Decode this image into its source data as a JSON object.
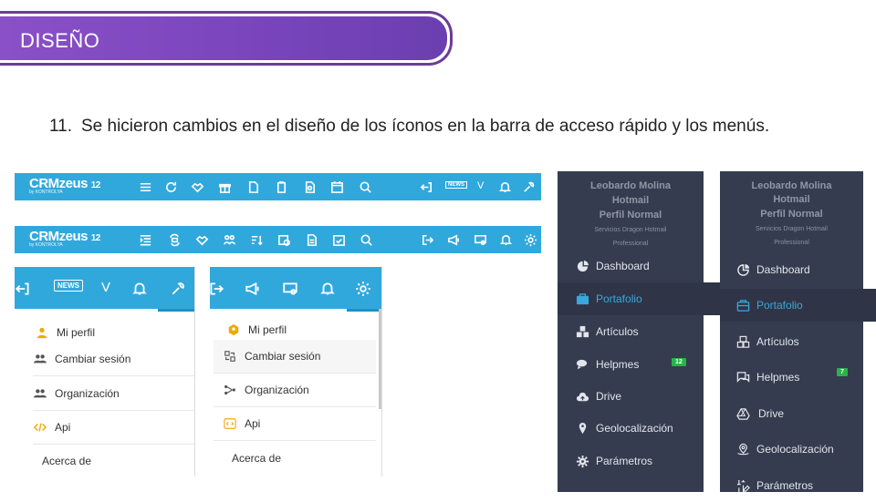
{
  "slide": {
    "title": "DISEÑO",
    "item_number": "11.",
    "item_text": "Se hicieron cambios en el diseño de los íconos en la barra de acceso rápido y los menús."
  },
  "colors": {
    "purple": "#7a45bd",
    "toolbar_blue": "#31a8dc",
    "sidebar_dark": "#353c4f",
    "active_blue": "#3aa7dd",
    "badge_green": "#29b34a"
  },
  "toolbars": {
    "old": {
      "logo": "CRMzeus",
      "logo_sub": "by KONTROLYA",
      "news_label": "NEWS",
      "v_label": "V"
    },
    "new": {
      "logo": "CRMzeus",
      "logo_sub": "by KONTROLYA"
    }
  },
  "old_menu": {
    "news_label": "NEWS",
    "v_label": "V",
    "items": [
      {
        "label": "Mi perfil",
        "icon": "user-icon"
      },
      {
        "label": "Cambiar sesión",
        "icon": "users-icon"
      },
      {
        "label": "Organización",
        "icon": "users-icon"
      },
      {
        "label": "Api",
        "icon": "code-icon"
      },
      {
        "label": "Acerca de",
        "icon": ""
      }
    ]
  },
  "new_menu": {
    "items": [
      {
        "label": "Mi perfil",
        "icon": "hexagon-user-icon"
      },
      {
        "label": "Cambiar sesión",
        "icon": "switch-session-icon"
      },
      {
        "label": "Organización",
        "icon": "hierarchy-icon"
      },
      {
        "label": "Api",
        "icon": "code-icon"
      },
      {
        "label": "Acerca de",
        "icon": ""
      }
    ]
  },
  "old_sidebar": {
    "user_name_1": "Leobardo Molina",
    "user_name_2": "Hotmail",
    "profile": "Perfil Normal",
    "company_1": "Servicios Dragon Hotmail",
    "company_2": "Professional",
    "nav": [
      {
        "label": "Dashboard",
        "icon": "pie-chart-icon"
      },
      {
        "label": "Portafolio",
        "icon": "briefcase-icon"
      },
      {
        "label": "Artículos",
        "icon": "cubes-icon"
      },
      {
        "label": "Helpmes",
        "icon": "chat-icon",
        "badge": "12"
      },
      {
        "label": "Drive",
        "icon": "cloud-upload-icon"
      },
      {
        "label": "Geolocalización",
        "icon": "map-pin-icon"
      },
      {
        "label": "Parámetros",
        "icon": "gear-icon"
      }
    ]
  },
  "new_sidebar": {
    "user_name_1": "Leobardo Molina",
    "user_name_2": "Hotmail",
    "profile": "Perfil Normal",
    "company_1": "Servicios Dragon Hotmail",
    "company_2": "Professional",
    "nav": [
      {
        "label": "Dashboard",
        "icon": "pie-chart-outline-icon"
      },
      {
        "label": "Portafolio",
        "icon": "briefcase-outline-icon"
      },
      {
        "label": "Artículos",
        "icon": "boxes-outline-icon"
      },
      {
        "label": "Helpmes",
        "icon": "chat-outline-icon",
        "badge": "7"
      },
      {
        "label": "Drive",
        "icon": "drive-triangle-icon"
      },
      {
        "label": "Geolocalización",
        "icon": "location-outline-icon"
      },
      {
        "label": "Parámetros",
        "icon": "settings-pen-icon"
      }
    ]
  }
}
